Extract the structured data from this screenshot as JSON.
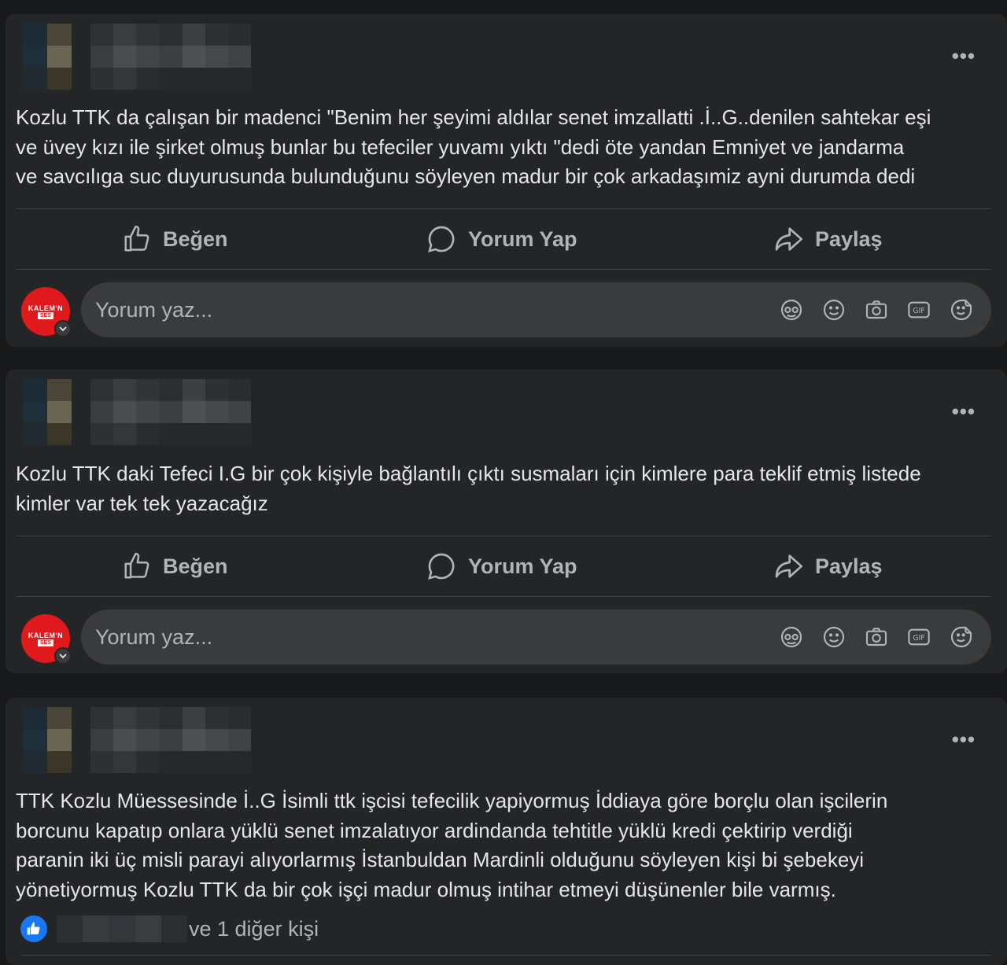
{
  "posts": [
    {
      "text": "Kozlu TTK da çalışan bir madenci \"Benim her şeyimi aldılar senet imzallatti .İ..G..denilen sahtekar eşi\nve üvey kızı ile şirket olmuş bunlar bu tefeciler yuvamı yıktı \"dedi öte yandan Emniyet ve jandarma\nve savcılıga suc duyurusunda bulunduğunu söyleyen madur bir çok arkadaşımiz ayni durumda dedi"
    },
    {
      "text": "Kozlu TTK daki Tefeci I.G bir çok kişiyle bağlantılı çıktı susmaları için kimlere para teklif etmiş listede\nkimler var tek tek yazacağız"
    },
    {
      "text": "TTK Kozlu Müessesinde İ..G  İsimli ttk işcisi tefecilik yapiyormuş İddiaya göre borçlu olan işcilerin\nborcunu kapatıp onlara yüklü senet imzalatıyor ardindanda tehtitle yüklü kredi çektirip verdiği\nparanin iki üç misli parayi alıyorlarmış İstanbuldan Mardinli olduğunu söyleyen kişi bi şebekeyi\nyönetiyormuş Kozlu TTK da bir çok işçi madur olmuş intihar etmeyi düşünenler bile varmış."
    }
  ],
  "actions": {
    "like_label": "Beğen",
    "comment_label": "Yorum Yap",
    "share_label": "Paylaş"
  },
  "comment_box": {
    "placeholder": "Yorum yaz...",
    "avatar_top": "KALEM'N",
    "avatar_bottom": "SES",
    "icons": [
      "avatar-sticker-icon",
      "emoji-icon",
      "camera-icon",
      "gif-icon",
      "sticker-icon"
    ]
  },
  "more_label": "•••",
  "likes": {
    "text": "ve 1 diğer kişi"
  },
  "colors": {
    "page_bg": "#18191a",
    "card_bg": "#242526",
    "input_bg": "#3a3b3c",
    "primary_text": "#e4e6eb",
    "secondary_text": "#b0b3b8",
    "like_blue": "#1877f2",
    "avatar_red": "#e0191c"
  }
}
